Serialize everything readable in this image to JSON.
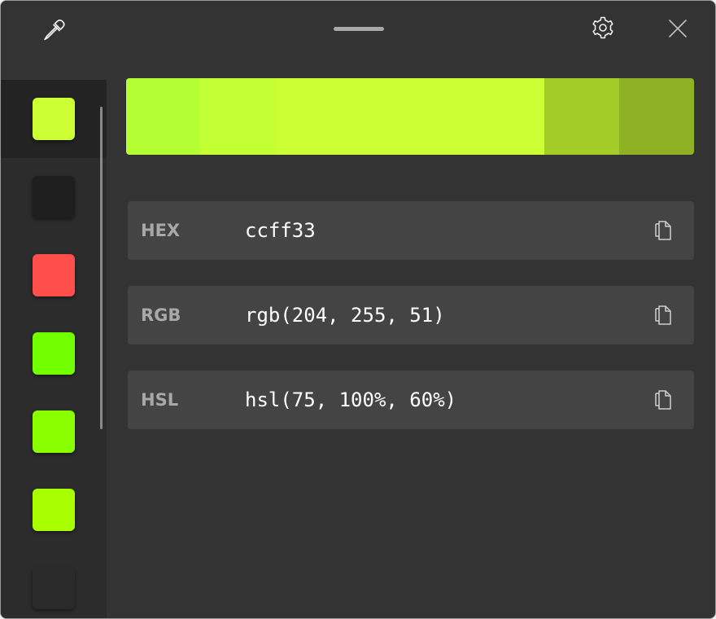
{
  "toolbar": {
    "picker_icon": "eyedropper-icon",
    "settings_icon": "gear-icon",
    "close_icon": "close-icon"
  },
  "history": {
    "colors": [
      "#ccff33",
      "#1e1e1e",
      "#ff4f4a",
      "#72ff00",
      "#8aff00",
      "#a8ff00",
      "#2a2a2a"
    ],
    "selected_index": 0
  },
  "shades": [
    "#b3ff33",
    "#c2ff33",
    "#ccff33",
    "#ccff33",
    "#a3cc29",
    "#8fb224"
  ],
  "formats": [
    {
      "label": "HEX",
      "value": "ccff33",
      "copy_icon": "copy-icon"
    },
    {
      "label": "RGB",
      "value": "rgb(204, 255, 51)",
      "copy_icon": "copy-icon"
    },
    {
      "label": "HSL",
      "value": "hsl(75, 100%, 60%)",
      "copy_icon": "copy-icon"
    }
  ]
}
